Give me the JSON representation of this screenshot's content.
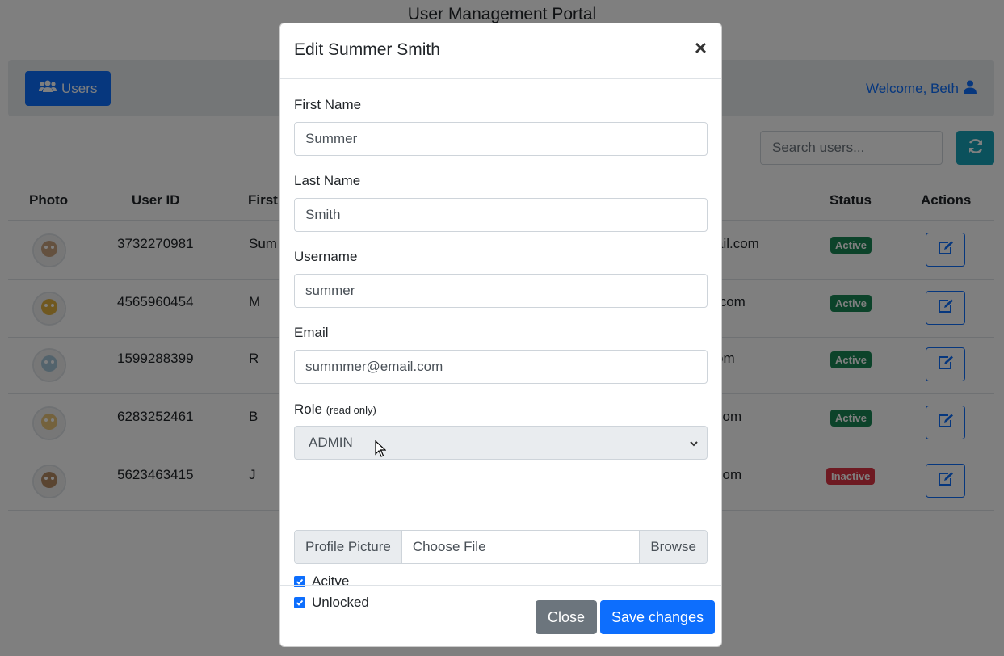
{
  "page": {
    "title": "User Management Portal"
  },
  "navbar": {
    "users_label": "Users",
    "welcome_label": "Welcome, Beth"
  },
  "search": {
    "placeholder": "Search users..."
  },
  "table": {
    "headers": {
      "photo": "Photo",
      "user_id": "User ID",
      "first_name": "First",
      "status": "Status",
      "actions": "Actions"
    },
    "rows": [
      {
        "user_id": "3732270981",
        "first_name": "Sum",
        "email": "ail.com",
        "status": "Active",
        "status_color": "#198754",
        "avatar_color": "#c9a37f"
      },
      {
        "user_id": "4565960454",
        "first_name": "M",
        "email": ".com",
        "status": "Active",
        "status_color": "#198754",
        "avatar_color": "#e0b040"
      },
      {
        "user_id": "1599288399",
        "first_name": "R",
        "email": "om",
        "status": "Active",
        "status_color": "#198754",
        "avatar_color": "#a7c6d8"
      },
      {
        "user_id": "6283252461",
        "first_name": "B",
        "email": "com",
        "status": "Active",
        "status_color": "#198754",
        "avatar_color": "#e8c47a"
      },
      {
        "user_id": "5623463415",
        "first_name": "J",
        "email": "com",
        "status": "Inactive",
        "status_color": "#dc3545",
        "avatar_color": "#b58a63"
      }
    ]
  },
  "modal": {
    "title": "Edit Summer Smith",
    "close_symbol": "×",
    "first_name_label": "First Name",
    "first_name_value": "Summer",
    "last_name_label": "Last Name",
    "last_name_value": "Smith",
    "username_label": "Username",
    "username_value": "summer",
    "email_label": "Email",
    "email_value": "summmer@email.com",
    "role_label": "Role",
    "role_note": "(read only)",
    "role_value": "ADMIN",
    "profile_picture_label": "Profile Picture",
    "choose_file_label": "Choose File",
    "browse_label": "Browse",
    "active_label": "Acitve",
    "active_checked": true,
    "unlocked_label": "Unlocked",
    "unlocked_checked": true,
    "close_button": "Close",
    "save_button": "Save changes"
  },
  "colors": {
    "primary": "#0d6efd",
    "info": "#17a2b8",
    "secondary": "#6c757d",
    "success": "#198754",
    "danger": "#dc3545"
  }
}
